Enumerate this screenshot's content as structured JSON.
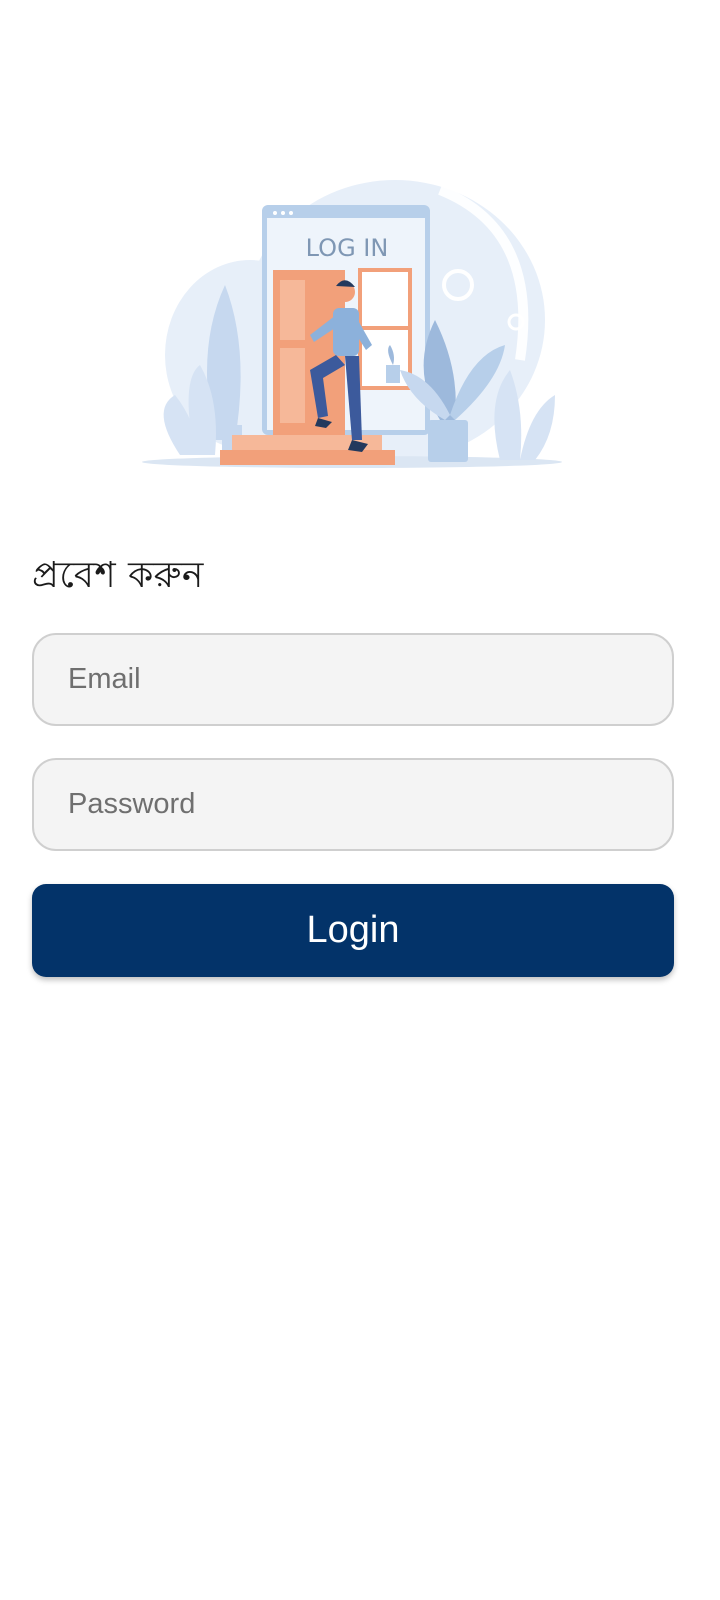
{
  "illustration": {
    "sign_text": "LOG IN",
    "description_icon": "login-illustration"
  },
  "form": {
    "title": "প্রবেশ করুন",
    "email": {
      "placeholder": "Email",
      "value": ""
    },
    "password": {
      "placeholder": "Password",
      "value": ""
    },
    "login_label": "Login"
  },
  "colors": {
    "primary": "#033369",
    "field_bg": "#f4f4f4",
    "field_border": "#cfcfcf",
    "illustration_blue": "#c9dcf2",
    "illustration_orange": "#f2a07a"
  }
}
